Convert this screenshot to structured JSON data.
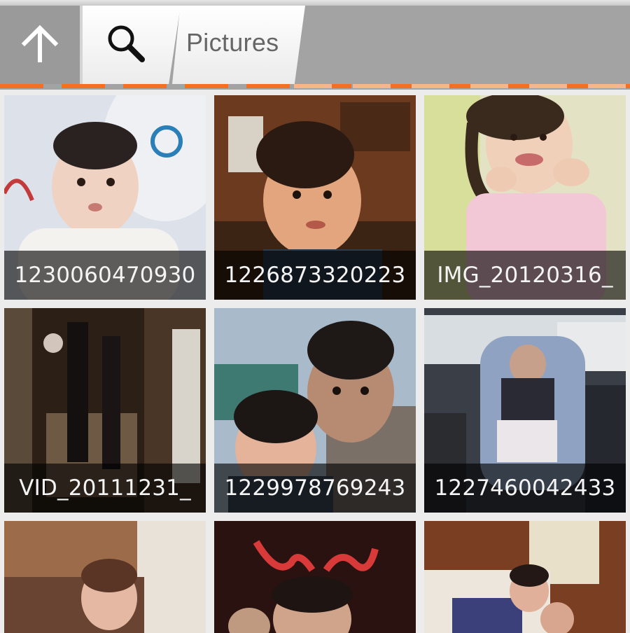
{
  "header": {
    "up_icon": "arrow-up-icon",
    "search_icon": "search-icon",
    "path_label": "Pictures",
    "accent_color": "#f37021"
  },
  "tiles": [
    {
      "caption": "1230060470930",
      "swatch": [
        "#d9dde6",
        "#c8b8a8",
        "#2a3b6b"
      ]
    },
    {
      "caption": "1226873320223",
      "swatch": [
        "#6a3a1e",
        "#c98a5a",
        "#3a2414"
      ]
    },
    {
      "caption": "IMG_20120316_",
      "swatch": [
        "#e7e6c8",
        "#d8a89a",
        "#f1c9d8"
      ]
    },
    {
      "caption": "VID_20111231_",
      "swatch": [
        "#3c2a1c",
        "#6e5a44",
        "#1e1712"
      ]
    },
    {
      "caption": "1229978769243",
      "swatch": [
        "#9fb3c6",
        "#8f6a55",
        "#4a3a36"
      ]
    },
    {
      "caption": "1227460042433",
      "swatch": [
        "#5a6474",
        "#9aa8c6",
        "#2e2f36"
      ]
    },
    {
      "caption": "",
      "swatch": [
        "#9c6a48",
        "#e7d7c4",
        "#6b4a34"
      ]
    },
    {
      "caption": "",
      "swatch": [
        "#3a1412",
        "#c83a3a",
        "#231010"
      ]
    },
    {
      "caption": "",
      "swatch": [
        "#8b4a2a",
        "#ede4d8",
        "#3a2a6a"
      ]
    }
  ]
}
